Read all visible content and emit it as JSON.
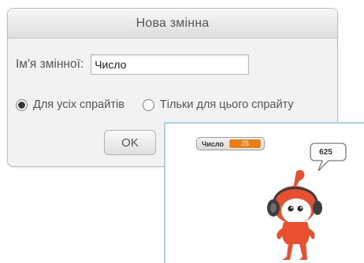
{
  "dialog": {
    "title": "Нова змінна",
    "name_label": "Ім'я змінної:",
    "name_value": "Число",
    "scope_options": [
      {
        "label": "Для усіх спрайтів",
        "selected": true
      },
      {
        "label": "Тільки для цього спрайту",
        "selected": false
      }
    ],
    "ok_label": "OK"
  },
  "stage": {
    "monitor": {
      "name": "Число",
      "value": "25",
      "value_color": "#ee7d16"
    },
    "speech_text": "625",
    "sprite_colors": {
      "body": "#e8502f",
      "headphones": "#3d3d3d",
      "face": "#ffffff"
    }
  }
}
